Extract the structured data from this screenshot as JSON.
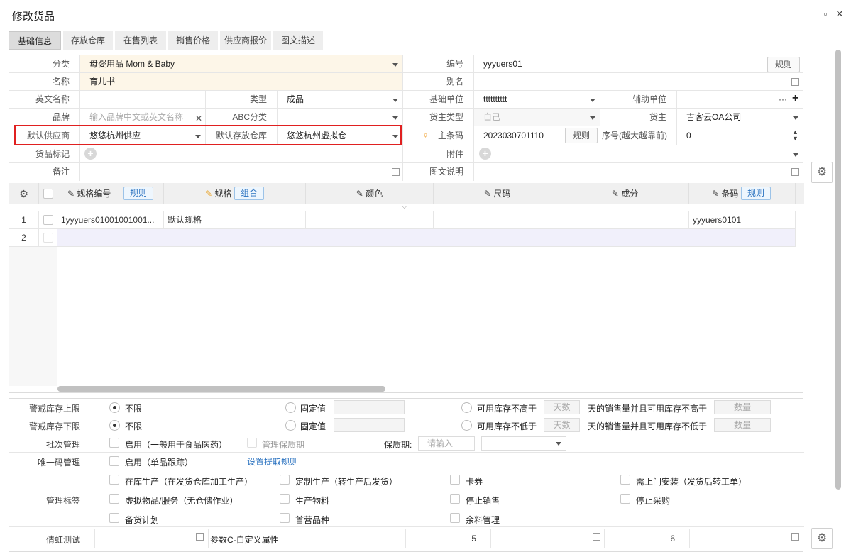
{
  "window": {
    "title": "修改货品",
    "restore_icon": "▫",
    "close_icon": "✕"
  },
  "tabs": [
    "基础信息",
    "存放仓库",
    "在售列表",
    "销售价格",
    "供应商报价",
    "图文描述"
  ],
  "form": {
    "category_label": "分类",
    "category_value": "母婴用品 Mom & Baby",
    "code_label": "编号",
    "code_value": "yyyuers01",
    "rule_btn": "规则",
    "name_label": "名称",
    "name_value": "育儿书",
    "alias_label": "别名",
    "en_name_label": "英文名称",
    "type_label": "类型",
    "type_value": "成品",
    "base_unit_label": "基础单位",
    "base_unit_value": "tttttttttt",
    "aux_unit_label": "辅助单位",
    "ellipsis": "···",
    "plus": "+",
    "brand_label": "品牌",
    "brand_placeholder": "输入品牌中文或英文名称",
    "abc_label": "ABC分类",
    "owner_type_label": "货主类型",
    "owner_type_value": "自己",
    "owner_label": "货主",
    "owner_value": "吉客云OA公司",
    "default_supplier_label": "默认供应商",
    "default_supplier_value": "悠悠杭州供应",
    "default_warehouse_label": "默认存放仓库",
    "default_warehouse_value": "悠悠杭州虚拟仓",
    "barcode_label": "主条码",
    "barcode_value": "2023030701110",
    "barcode_rule": "规则",
    "seq_label": "序号(越大越靠前)",
    "seq_value": "0",
    "tag_label": "货品标记",
    "attach_label": "附件",
    "remark_label": "备注",
    "desc_label": "图文说明"
  },
  "grid": {
    "headers": {
      "spec_code": "规格编号",
      "spec_rule": "规则",
      "spec": "规格",
      "spec_combo": "组合",
      "color": "颜色",
      "size": "尺码",
      "composition": "成分",
      "barcode": "条码",
      "barcode_rule": "规则"
    },
    "rows": [
      {
        "num": "1",
        "spec_code": "1yyyuers01001001001...",
        "spec": "默认规格",
        "barcode": "yyyuers0101"
      },
      {
        "num": "2",
        "spec_code": "",
        "spec": "",
        "barcode": ""
      }
    ]
  },
  "bottom": {
    "upper_label": "警戒库存上限",
    "lower_label": "警戒库存下限",
    "unlimited": "不限",
    "fixed": "固定值",
    "avail_not_higher": "可用库存不高于",
    "avail_not_lower": "可用库存不低于",
    "days_placeholder": "天数",
    "qty_placeholder": "数量",
    "upper_tail": "天的销售量并且可用库存不高于",
    "lower_tail": "天的销售量并且可用库存不低于",
    "batch_label": "批次管理",
    "batch_enable": "启用（一般用于食品医药）",
    "manage_shelf": "管理保质期",
    "shelf_label": "保质期:",
    "shelf_placeholder": "请输入",
    "unique_label": "唯一码管理",
    "unique_enable": "启用（单品跟踪）",
    "unique_rule": "设置提取规则",
    "tags_label": "管理标签",
    "tags": [
      "在库生产（在发货仓库加工生产）",
      "定制生产（转生产后发货）",
      "卡券",
      "需上门安装（发货后转工单）",
      "虚拟物品/服务（无仓储作业）",
      "生产物料",
      "停止销售",
      "停止采购",
      "备货计划",
      "首营品种",
      "余料管理"
    ],
    "custom_label": "倩虹测试",
    "param_c_label": "参数C-自定义属性",
    "val5": "5",
    "val6": "6"
  }
}
